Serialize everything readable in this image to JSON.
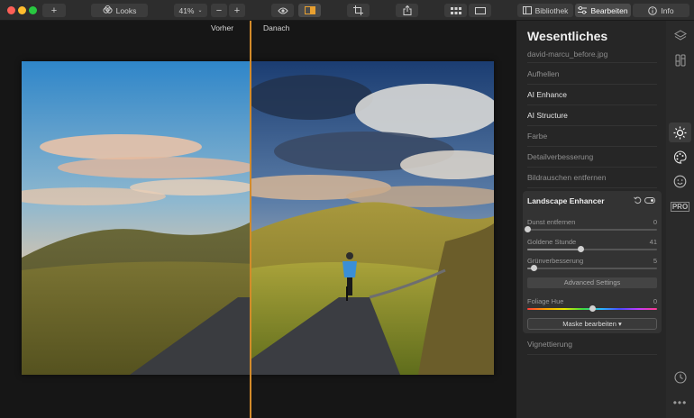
{
  "toolbar": {
    "looks_label": "Looks",
    "zoom": "41%",
    "zoom_minus": "−",
    "zoom_plus": "+",
    "add": "+",
    "tabs": [
      {
        "label": "Bibliothek",
        "active": false
      },
      {
        "label": "Bearbeiten",
        "active": true
      },
      {
        "label": "Info",
        "active": false
      }
    ]
  },
  "canvas": {
    "before_label": "Vorher",
    "after_label": "Danach",
    "split_color": "#d38b2a"
  },
  "panel": {
    "title": "Wesentliches",
    "file_name": "david-marcu_before.jpg",
    "sections_top": [
      {
        "label": "Aufhellen",
        "bright": false
      },
      {
        "label": "AI Enhance",
        "bright": true
      },
      {
        "label": "AI Structure",
        "bright": true
      },
      {
        "label": "Farbe",
        "bright": false
      },
      {
        "label": "Detailverbesserung",
        "bright": false
      },
      {
        "label": "Bildrauschen entfernen",
        "bright": false
      }
    ],
    "tool": {
      "title": "Landscape Enhancer",
      "sliders": [
        {
          "label": "Dunst entfernen",
          "value": 0,
          "fraction": 0.0
        },
        {
          "label": "Goldene Stunde",
          "value": 41,
          "fraction": 0.41
        },
        {
          "label": "Grünverbesserung",
          "value": 5,
          "fraction": 0.05
        }
      ],
      "advanced_label": "Advanced Settings",
      "hue": {
        "label": "Foliage Hue",
        "value": 0,
        "fraction": 0.5
      },
      "mask_label": "Maske bearbeiten ▾"
    },
    "sections_bottom": [
      {
        "label": "Vignettierung",
        "bright": false
      }
    ]
  },
  "rail": {
    "icons": [
      "layers-icon",
      "sliders-icon",
      "sun-icon",
      "palette-icon",
      "face-icon",
      "pro-badge",
      "history-icon",
      "more-icon"
    ],
    "pro_label": "PRO",
    "more_label": "•••"
  }
}
